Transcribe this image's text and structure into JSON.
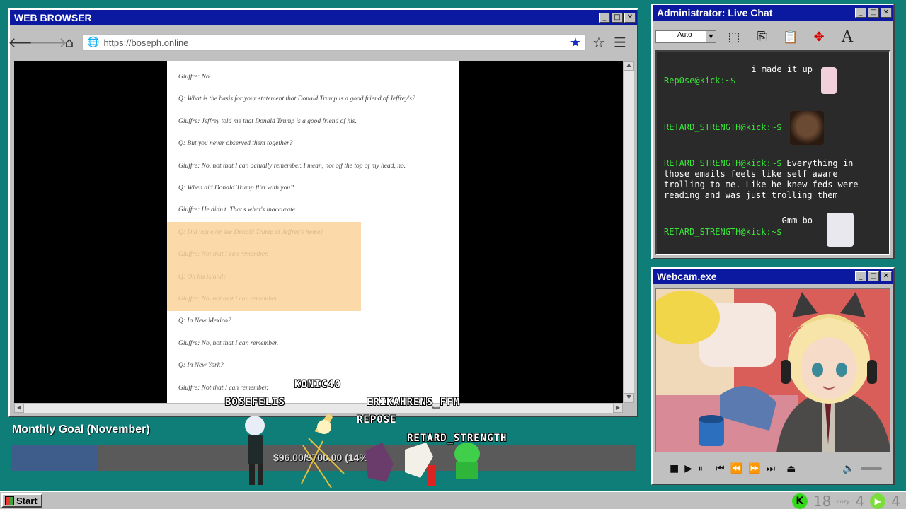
{
  "browser": {
    "title": "WEB BROWSER",
    "url": "https://boseph.online",
    "doc_lines": [
      {
        "text": "Giuffre: No.",
        "faded": false
      },
      {
        "text": "Q: What is the basis for your statement that Donald Trump is a good friend of Jeffrey's?",
        "faded": false
      },
      {
        "text": "Giuffre: Jeffrey told me that Donald Trump is a good friend of his.",
        "faded": false
      },
      {
        "text": "Q: But you never observed them together?",
        "faded": false
      },
      {
        "text": "Giuffre: No, not that I can actually remember. I mean, not off the top of my head, no.",
        "faded": false
      },
      {
        "text": "Q: When did Donald Trump flirt with you?",
        "faded": false
      },
      {
        "text": "Giuffre: He didn't. That's what's inaccurate.",
        "faded": false
      },
      {
        "text": "Q: Did you ever see Donald Trump at Jeffrey's home?",
        "faded": true
      },
      {
        "text": "Giuffre: Not that I can remember.",
        "faded": true
      },
      {
        "text": "Q: On his island?",
        "faded": true
      },
      {
        "text": "Giuffre: No, not that I can remember.",
        "faded": true
      },
      {
        "text": "Q: In New Mexico?",
        "faded": false
      },
      {
        "text": "Giuffre: No, not that I can remember.",
        "faded": false
      },
      {
        "text": "Q: In New York?",
        "faded": false
      },
      {
        "text": "Giuffre: Not that I can remember.",
        "faded": false
      }
    ]
  },
  "chat": {
    "title": "Administrator: Live Chat",
    "size_select": "Auto",
    "messages": [
      {
        "user": "",
        "text": "i made it up",
        "align": "right"
      },
      {
        "user": "Rep0se@kick:~$",
        "text": ""
      },
      {
        "user": "RETARD_STRENGTH@kick:~$",
        "text": ""
      },
      {
        "user": "RETARD_STRENGTH@kick:~$",
        "text": " Everything in those emails feels like self aware trolling to me. Like he knew feds were reading and was just trolling them"
      },
      {
        "user": "",
        "text": "Gmm bo",
        "align": "right"
      },
      {
        "user": "RETARD_STRENGTH@kick:~$",
        "text": ""
      }
    ]
  },
  "webcam": {
    "title": "Webcam.exe"
  },
  "goal": {
    "title": "Monthly Goal (November)",
    "text": "$96.00/$700.00 (14%)",
    "progress": 0.14
  },
  "avatars": [
    "KONIC40",
    "BOSEFELIS",
    "ERIKAHRENS_FFM",
    "REP0SE",
    "RETARD_STRENGTH"
  ],
  "taskbar": {
    "start": "Start",
    "count1": "18",
    "cozy": "cozy",
    "count2": "4",
    "count3": "4"
  },
  "colors": {
    "title_blue": "#0b18a0",
    "desktop": "#0f7d78",
    "chat_user": "#39e639",
    "kick_green": "#34d91c"
  }
}
